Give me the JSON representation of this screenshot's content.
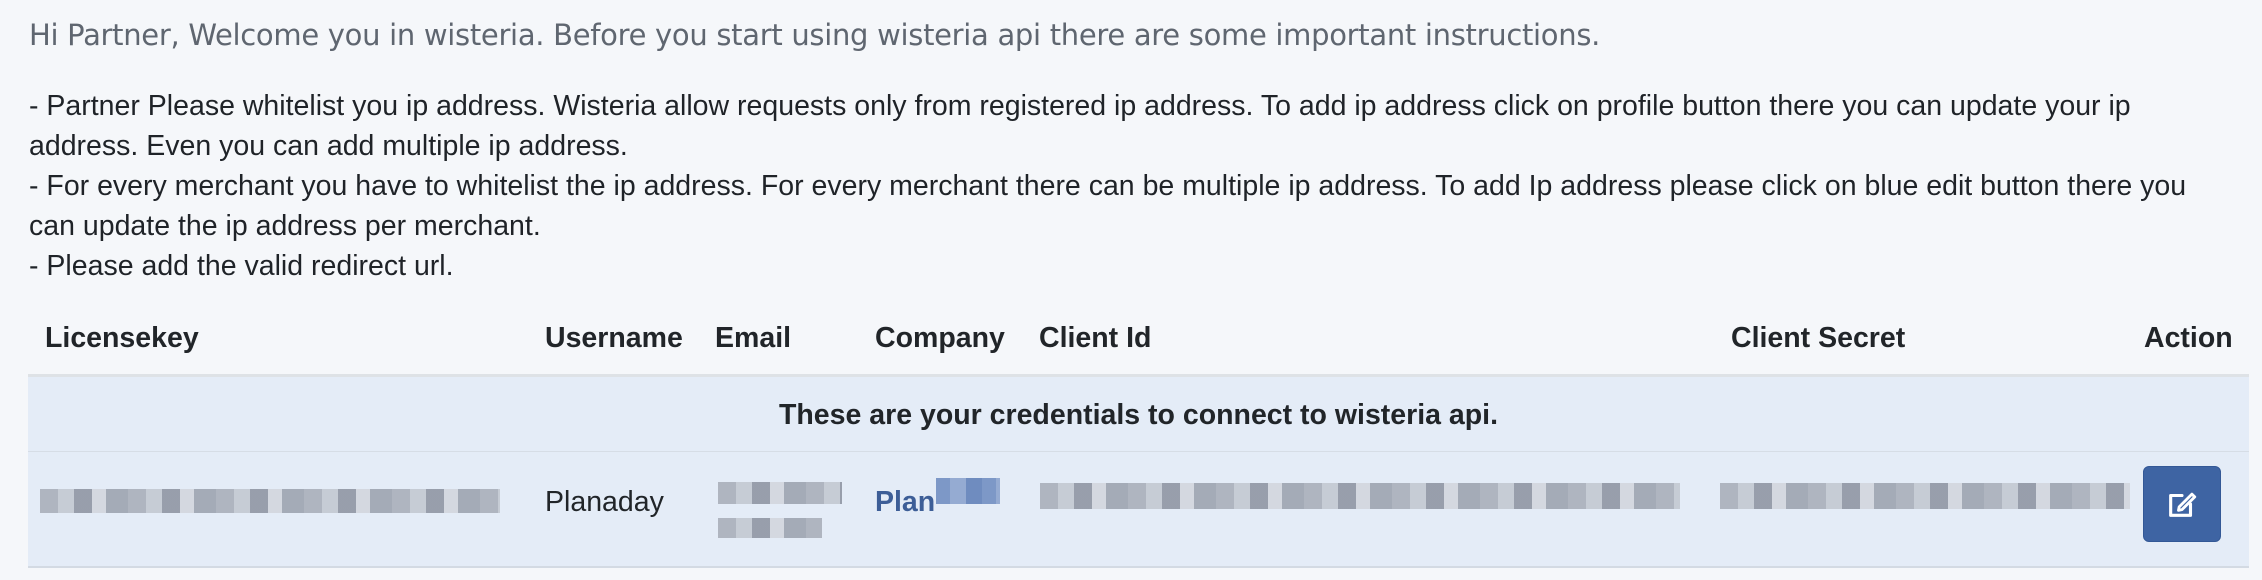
{
  "intro": {
    "welcome": "Hi Partner, Welcome you in wisteria. Before you start using wisteria api there are some important instructions.",
    "instructions": [
      "- Partner Please whitelist you ip address. Wisteria allow requests only from registered ip address. To add ip address click on profile button there you can update your ip address. Even you can add multiple ip address.",
      "- For every merchant you have to whitelist the ip address. For every merchant there can be multiple ip address. To add Ip address please click on blue edit button there you can update the ip address per merchant.",
      "- Please add the valid redirect url."
    ]
  },
  "table": {
    "headers": {
      "licensekey": "Licensekey",
      "username": "Username",
      "email": "Email",
      "company": "Company",
      "client_id": "Client Id",
      "client_secret": "Client Secret",
      "action": "Action"
    },
    "notice": "These are your credentials to connect to wisteria api.",
    "row": {
      "username": "Planaday",
      "company_visible": "Plan",
      "action_icon": "edit-icon"
    }
  },
  "colors": {
    "accent": "#3e64a3",
    "row_highlight": "#e4ecf7",
    "link": "#3d5e97"
  }
}
